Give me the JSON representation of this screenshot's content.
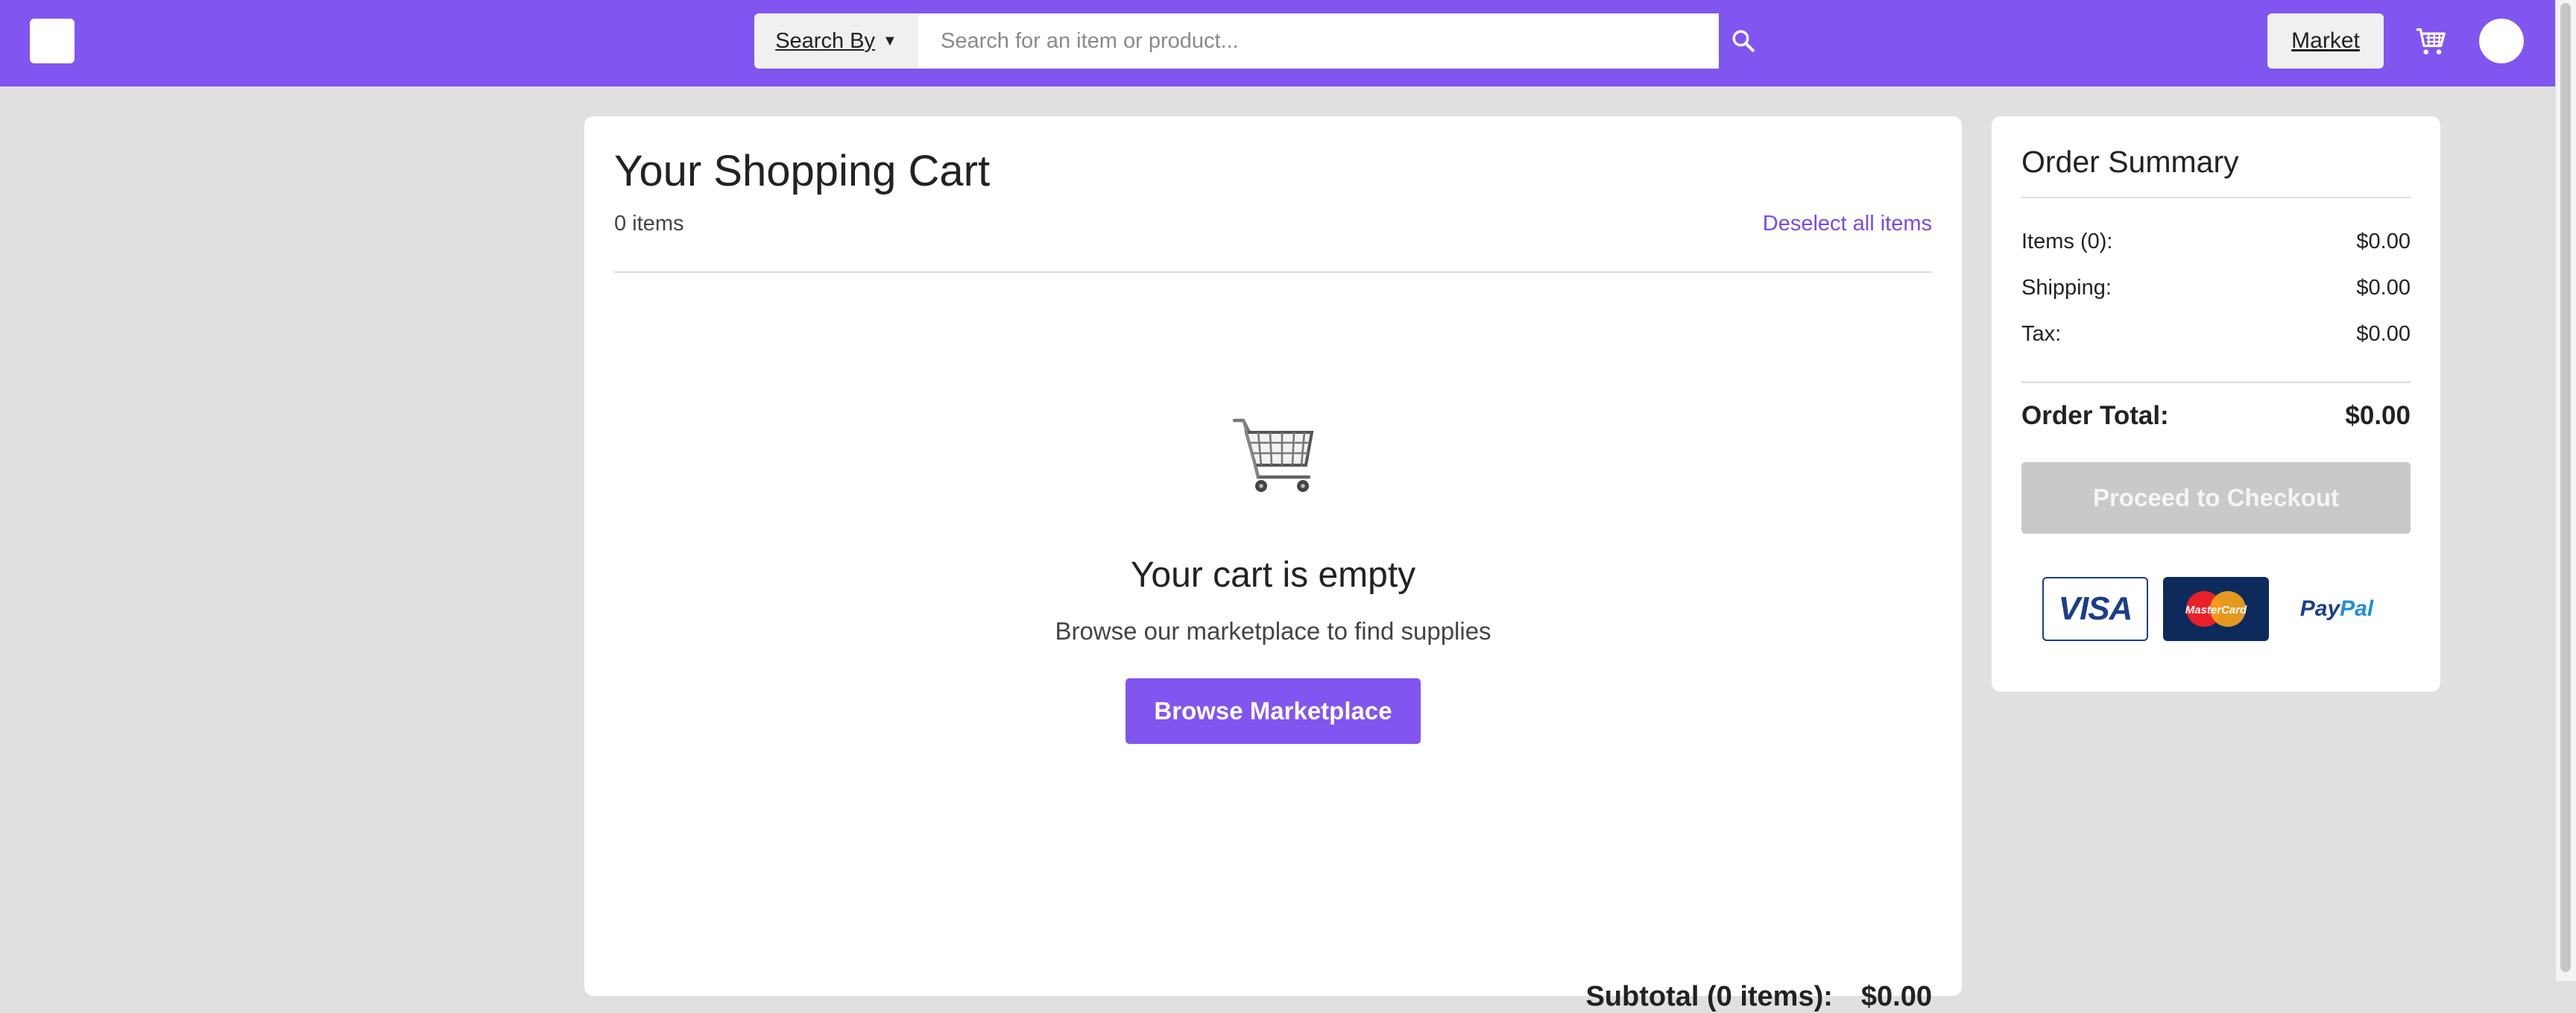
{
  "header": {
    "search_by_label": "Search By",
    "search_by_arrow": "▼",
    "search_placeholder": "Search for an item or product...",
    "market_label": "Market"
  },
  "cart": {
    "title": "Your Shopping Cart",
    "item_count": "0 items",
    "deselect_label": "Deselect all items",
    "empty_title": "Your cart is empty",
    "empty_subtitle": "Browse our marketplace to find supplies",
    "browse_button": "Browse Marketplace",
    "subtotal_label": "Subtotal (0 items):",
    "subtotal_value": "$0.00"
  },
  "summary": {
    "title": "Order Summary",
    "items_label": "Items (0):",
    "items_value": "$0.00",
    "shipping_label": "Shipping:",
    "shipping_value": "$0.00",
    "tax_label": "Tax:",
    "tax_value": "$0.00",
    "total_label": "Order Total:",
    "total_value": "$0.00",
    "checkout_button": "Proceed to Checkout",
    "payment_methods": {
      "visa": "VISA",
      "mastercard": "MasterCard",
      "paypal_pay": "Pay",
      "paypal_pal": "Pal"
    }
  },
  "colors": {
    "brand": "#8155f0",
    "link": "#7a4ae8",
    "disabled_button": "#c9c9c9",
    "page_background": "#e0e0e0"
  },
  "icons": [
    "logo",
    "search-icon",
    "cart-icon",
    "avatar",
    "shopping-cart-icon"
  ]
}
